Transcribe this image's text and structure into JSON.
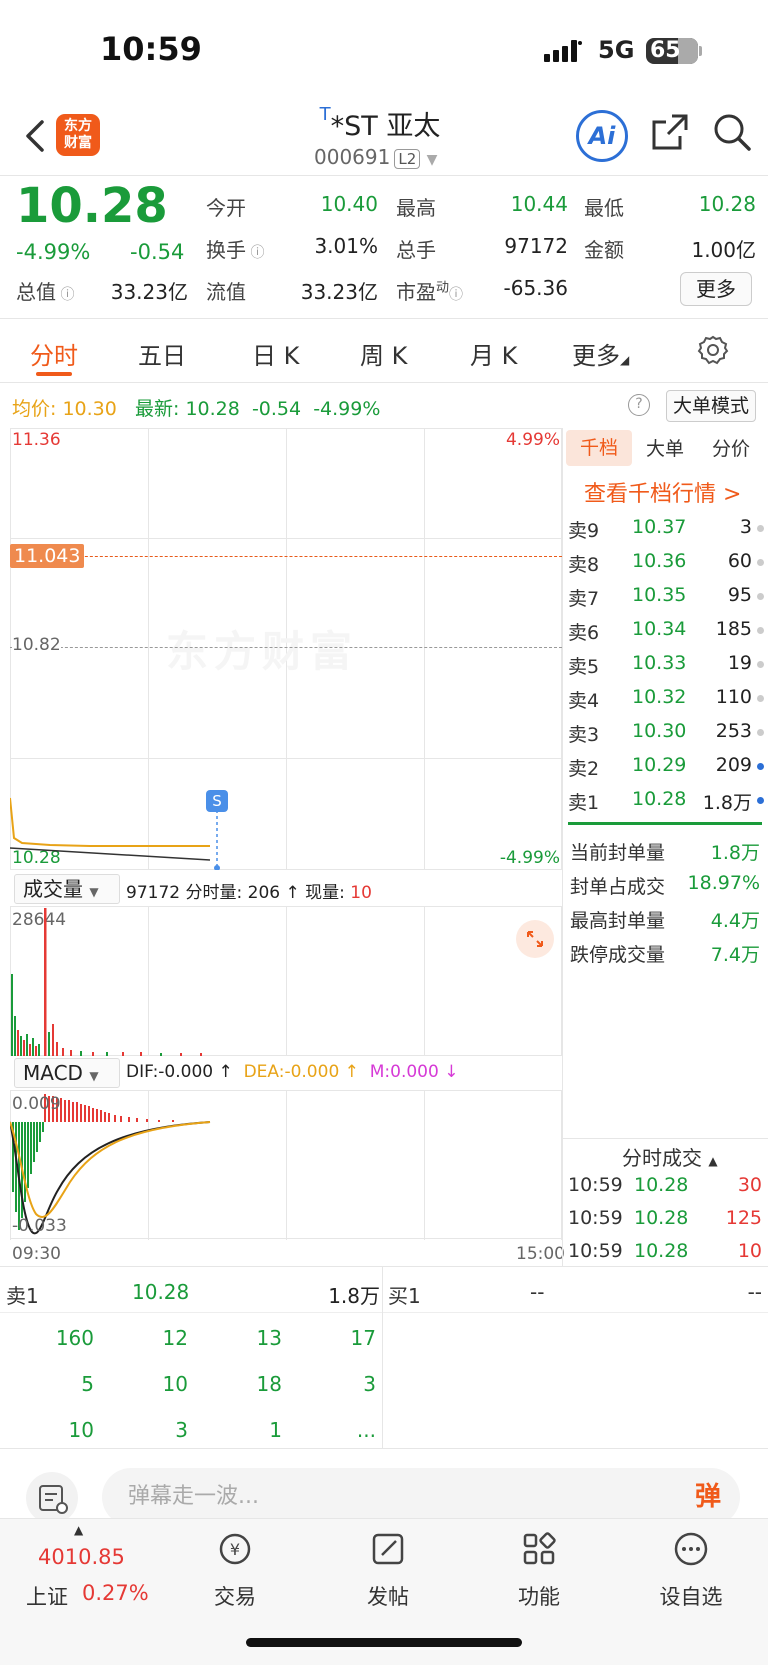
{
  "status": {
    "time": "10:59",
    "network": "5G",
    "battery": "65"
  },
  "header": {
    "logo_line1": "东方",
    "logo_line2": "财富",
    "title_prefix": "T",
    "title": "*ST 亚太",
    "code": "000691",
    "level": "L2",
    "ai_label": "Ai"
  },
  "quote": {
    "price": "10.28",
    "change_pct": "-4.99%",
    "change": "-0.54",
    "open_label": "今开",
    "open": "10.40",
    "high_label": "最高",
    "high": "10.44",
    "low_label": "最低",
    "low": "10.28",
    "turnover_label": "换手",
    "turnover": "3.01%",
    "volume_label": "总手",
    "volume": "97172",
    "amount_label": "金额",
    "amount": "1.00亿",
    "mktcap_label": "总值",
    "mktcap": "33.23亿",
    "float_label": "流值",
    "float": "33.23亿",
    "pe_label": "市盈",
    "pe_sup": "动",
    "pe": "-65.36",
    "more_label": "更多"
  },
  "tabs": [
    "分时",
    "五日",
    "日 K",
    "周 K",
    "月 K",
    "更多"
  ],
  "info": {
    "avg_label": "均价:",
    "avg": "10.30",
    "latest_label": "最新:",
    "latest": "10.28",
    "latest_chg": "-0.54",
    "latest_pct": "-4.99%",
    "big_order_mode": "大单模式"
  },
  "chart": {
    "y_top": "11.36",
    "pct_top": "4.99%",
    "limit_tag": "11.043",
    "prev_close": "10.82",
    "y_bottom": "10.28",
    "pct_bottom": "-4.99%",
    "watermark": "东方财富",
    "marker": "S",
    "vol_selector": "成交量",
    "vol_total": "97172",
    "vol_tick_label": "分时量:",
    "vol_tick": "206",
    "vol_now_label": "现量:",
    "vol_now": "10",
    "vol_max": "28644",
    "macd_selector": "MACD",
    "dif": "DIF:-0.000",
    "dea": "DEA:-0.000",
    "m": "M:0.000",
    "macd_top": "0.009",
    "macd_bottom": "-0.033",
    "time_start": "09:30",
    "time_end": "15:00"
  },
  "right_panel": {
    "tabs": [
      "千档",
      "大单",
      "分价"
    ],
    "link": "查看千档行情 >",
    "asks": [
      {
        "label": "卖9",
        "price": "10.37",
        "qty": "3"
      },
      {
        "label": "卖8",
        "price": "10.36",
        "qty": "60"
      },
      {
        "label": "卖7",
        "price": "10.35",
        "qty": "95"
      },
      {
        "label": "卖6",
        "price": "10.34",
        "qty": "185"
      },
      {
        "label": "卖5",
        "price": "10.33",
        "qty": "19"
      },
      {
        "label": "卖4",
        "price": "10.32",
        "qty": "110"
      },
      {
        "label": "卖3",
        "price": "10.30",
        "qty": "253"
      },
      {
        "label": "卖2",
        "price": "10.29",
        "qty": "209"
      },
      {
        "label": "卖1",
        "price": "10.28",
        "qty": "1.8万"
      }
    ],
    "seal": [
      {
        "label": "当前封单量",
        "value": "1.8万"
      },
      {
        "label": "封单占成交",
        "value": "18.97%"
      },
      {
        "label": "最高封单量",
        "value": "4.4万"
      },
      {
        "label": "跌停成交量",
        "value": "7.4万"
      }
    ],
    "trades_title": "分时成交",
    "trades": [
      {
        "time": "10:59",
        "price": "10.28",
        "vol": "30"
      },
      {
        "time": "10:59",
        "price": "10.28",
        "vol": "125"
      },
      {
        "time": "10:59",
        "price": "10.28",
        "vol": "10"
      }
    ]
  },
  "depth": {
    "sell_label": "卖1",
    "sell_price": "10.28",
    "sell_qty": "1.8万",
    "buy_label": "买1",
    "buy_price": "--",
    "buy_qty": "--",
    "queue": [
      "160",
      "12",
      "13",
      "17",
      "5",
      "10",
      "18",
      "3",
      "10",
      "3",
      "1",
      "..."
    ]
  },
  "comment": {
    "placeholder": "弹幕走一波...",
    "danmu": "弹"
  },
  "tabbar": {
    "index_value": "4010.85",
    "index_name": "上证",
    "index_pct": "0.27%",
    "trade": "交易",
    "post": "发帖",
    "func": "功能",
    "watch": "设自选"
  }
}
